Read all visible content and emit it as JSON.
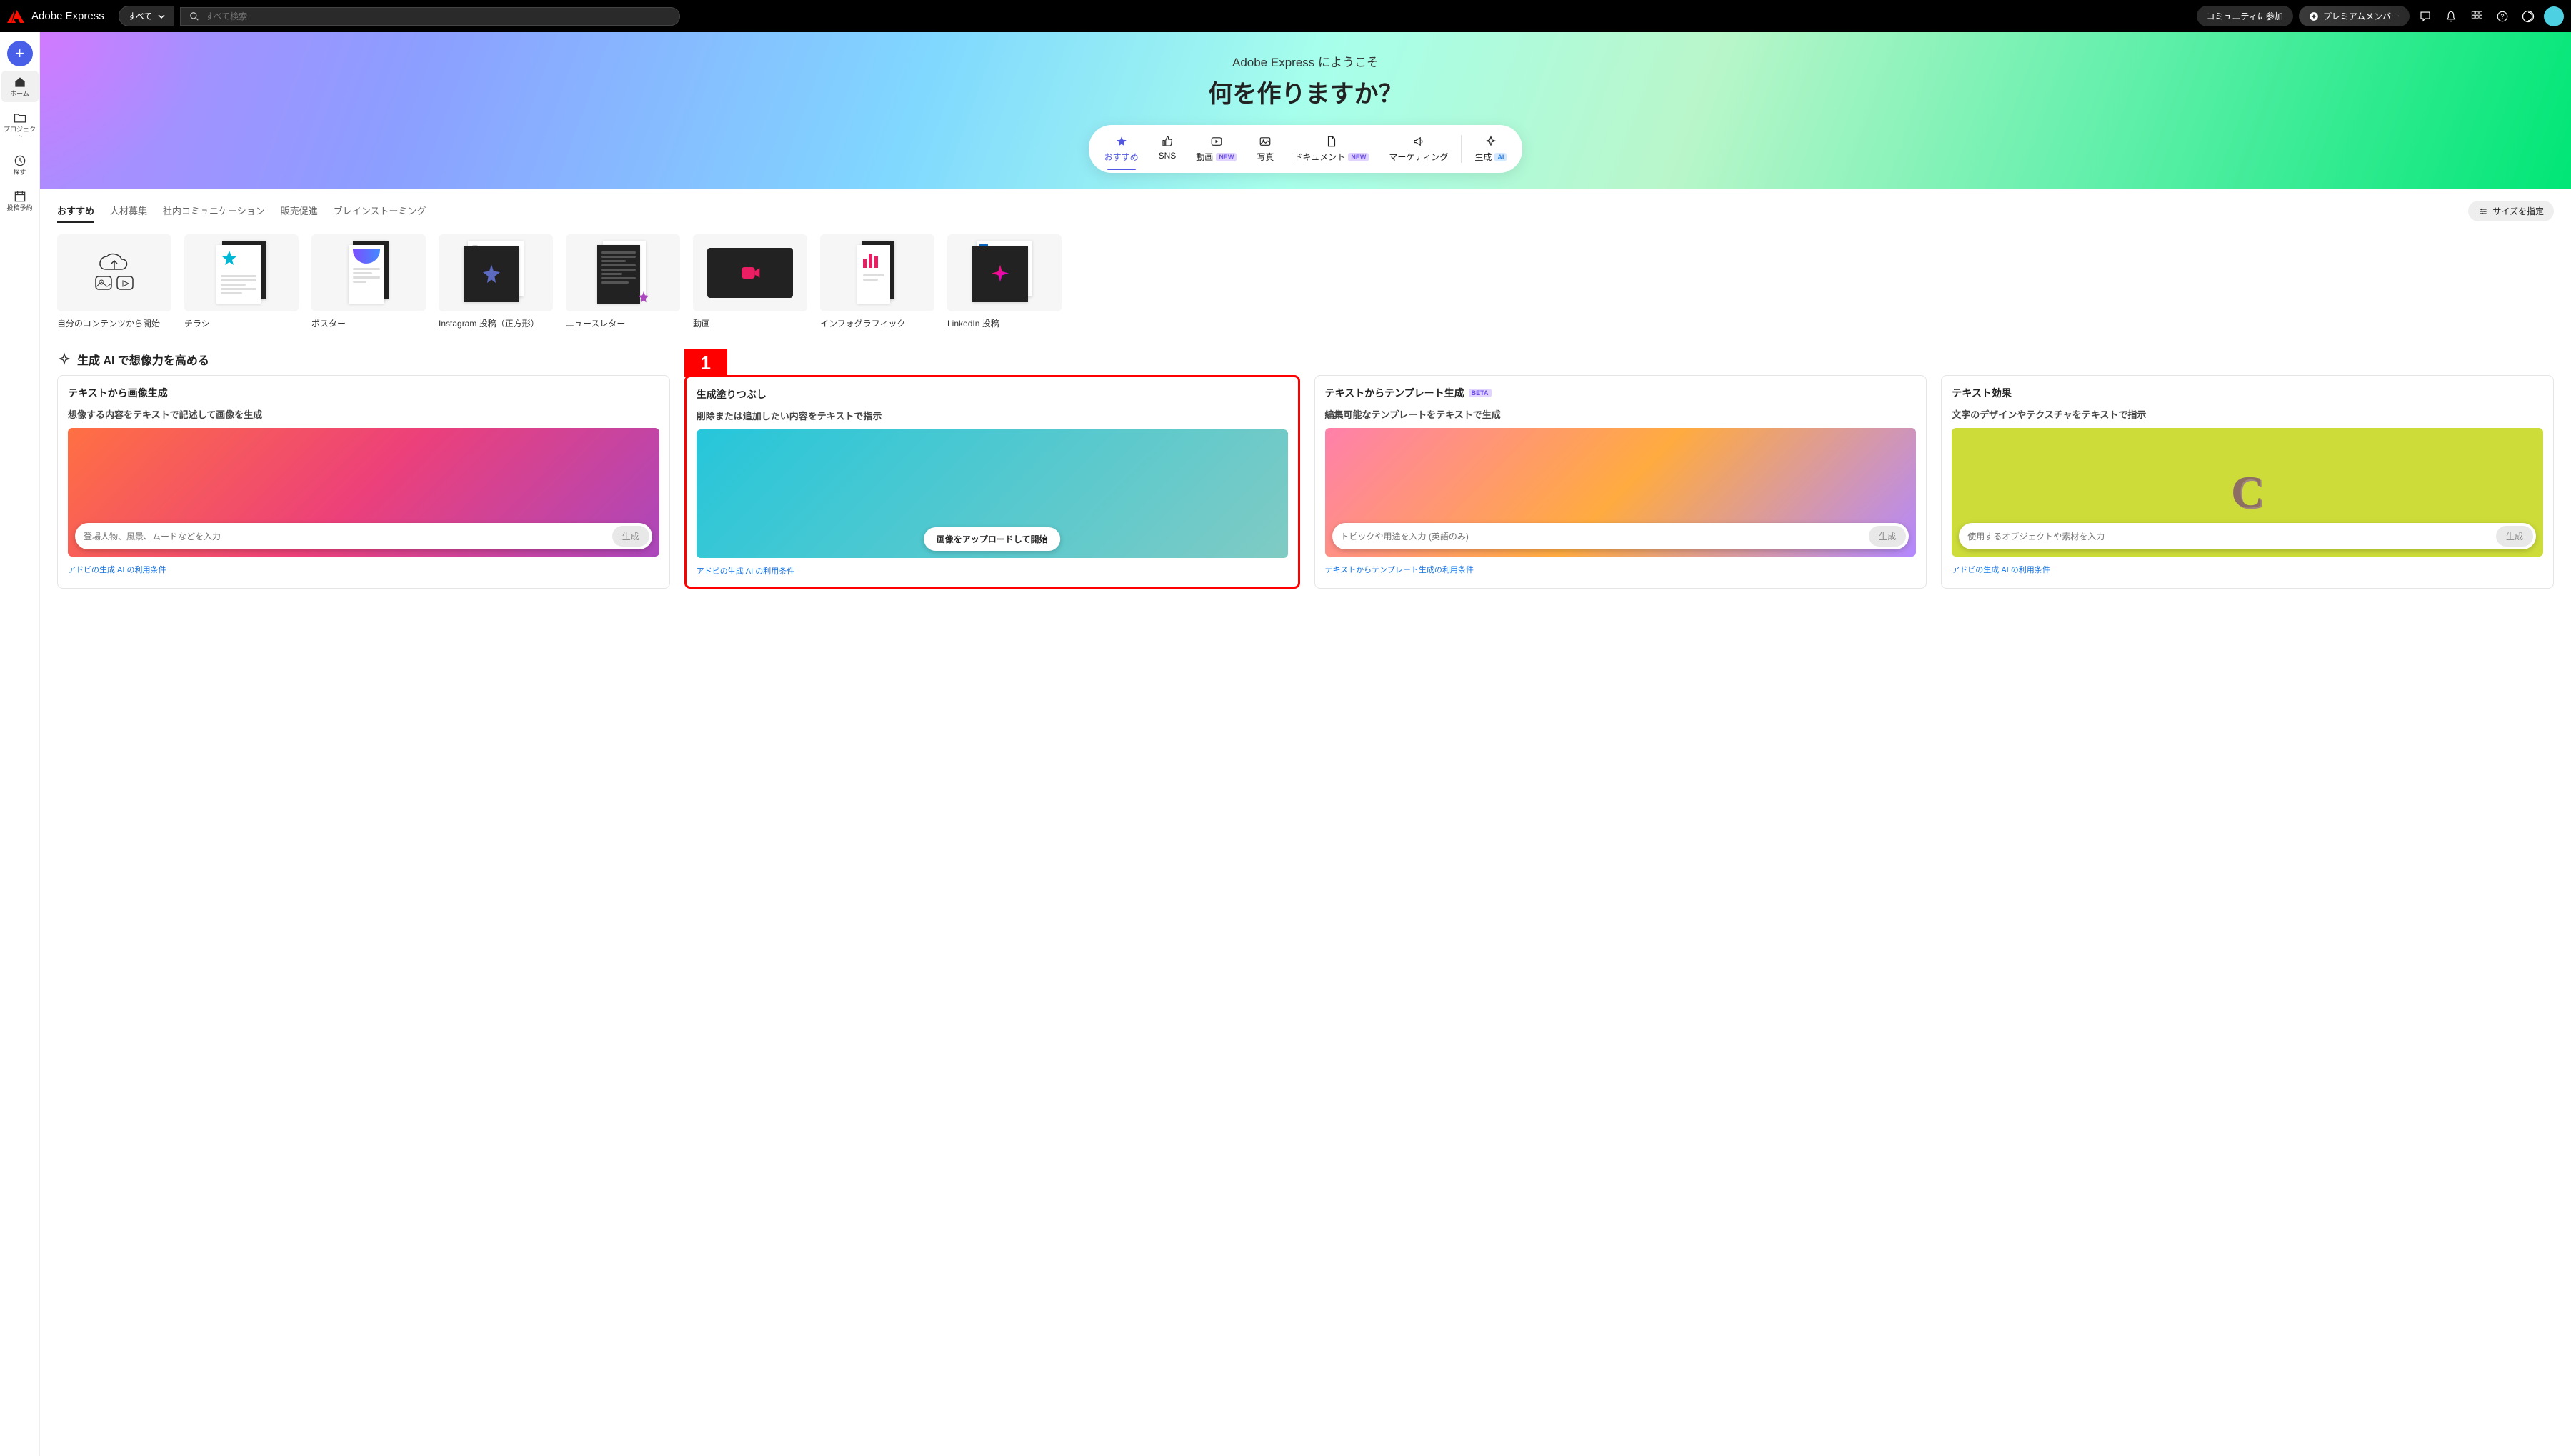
{
  "topbar": {
    "app_name": "Adobe Express",
    "dropdown_label": "すべて",
    "search_placeholder": "すべて検索",
    "community_btn": "コミュニティに参加",
    "premium_btn": "プレミアムメンバー"
  },
  "sidebar": {
    "home": "ホーム",
    "projects": "プロジェクト",
    "explore": "探す",
    "schedule": "投稿予約"
  },
  "hero": {
    "welcome": "Adobe Express にようこそ",
    "headline": "何を作りますか？"
  },
  "categories": [
    {
      "icon": "star",
      "label": "おすすめ",
      "active": true
    },
    {
      "icon": "thumb",
      "label": "SNS"
    },
    {
      "icon": "video",
      "label": "動画",
      "badge": "NEW",
      "badgeClass": "new"
    },
    {
      "icon": "photo",
      "label": "写真"
    },
    {
      "icon": "doc",
      "label": "ドキュメント",
      "badge": "NEW",
      "badgeClass": "new"
    },
    {
      "icon": "mega",
      "label": "マーケティング"
    },
    {
      "icon": "gen",
      "label": "生成",
      "badge": "AI",
      "badgeClass": "ai",
      "sep_before": true
    }
  ],
  "sub_tabs": {
    "items": [
      "おすすめ",
      "人材募集",
      "社内コミュニケーション",
      "販売促進",
      "ブレインストーミング"
    ],
    "active": 0,
    "size_btn": "サイズを指定"
  },
  "templates": [
    {
      "label": "自分のコンテンツから開始"
    },
    {
      "label": "チラシ"
    },
    {
      "label": "ポスター"
    },
    {
      "label": "Instagram 投稿（正方形）"
    },
    {
      "label": "ニュースレター"
    },
    {
      "label": "動画"
    },
    {
      "label": "インフォグラフィック"
    },
    {
      "label": "LinkedIn 投稿"
    }
  ],
  "genai": {
    "section_title": "生成 AI で想像力を高める",
    "cards": [
      {
        "title": "テキストから画像生成",
        "sub": "想像する内容をテキストで記述して画像を生成",
        "placeholder": "登場人物、風景、ムードなどを入力",
        "action": "生成",
        "link": "アドビの生成 AI の利用条件"
      },
      {
        "title": "生成塗りつぶし",
        "sub": "削除または追加したい内容をテキストで指示",
        "upload_btn": "画像をアップロードして開始",
        "link": "アドビの生成 AI の利用条件",
        "highlighted": true,
        "callout": "1"
      },
      {
        "title": "テキストからテンプレート生成",
        "badge": "BETA",
        "sub": "編集可能なテンプレートをテキストで生成",
        "placeholder": "トピックや用途を入力 (英語のみ)",
        "action": "生成",
        "link": "テキストからテンプレート生成の利用条件"
      },
      {
        "title": "テキスト効果",
        "sub": "文字のデザインやテクスチャをテキストで指示",
        "placeholder": "使用するオブジェクトや素材を入力",
        "action": "生成",
        "link": "アドビの生成 AI の利用条件"
      }
    ]
  }
}
